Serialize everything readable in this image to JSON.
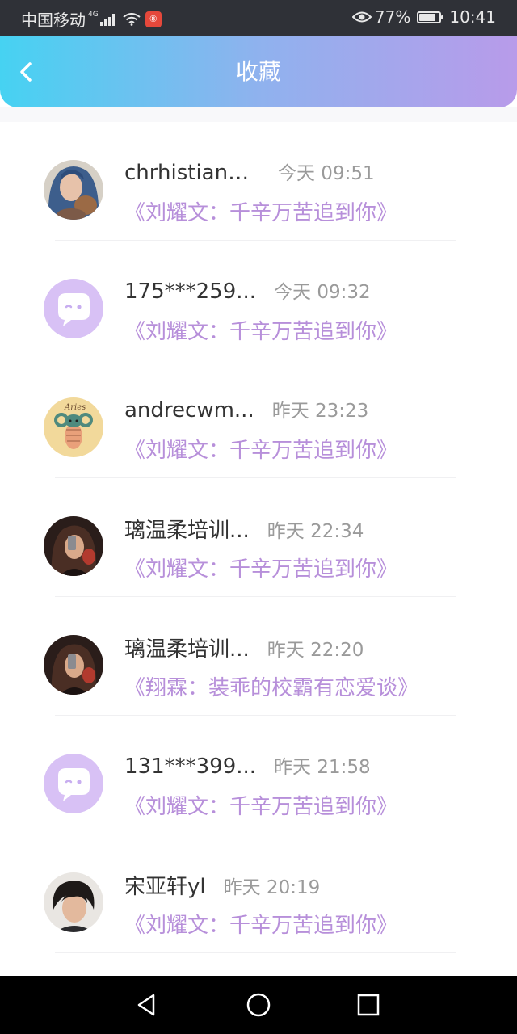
{
  "status_bar": {
    "carrier": "中国移动",
    "network": "4G",
    "app_badge": "⑧",
    "battery_percent": "77%",
    "battery_level": 0.77,
    "time": "10:41"
  },
  "header": {
    "title": "收藏",
    "back_icon": "chevron-left-icon",
    "gradient_colors": [
      "#46d2f2",
      "#b89bea"
    ]
  },
  "favorites": [
    {
      "username": "chrhistiand...",
      "time": "今天 09:51",
      "title": "《刘耀文：千辛万苦追到你》",
      "avatar": "photo-blue-hair"
    },
    {
      "username": "175***259...",
      "time": "今天 09:32",
      "title": "《刘耀文：千辛万苦追到你》",
      "avatar": "default-chat-bubble"
    },
    {
      "username": "andrecwm...",
      "time": "昨天 23:23",
      "title": "《刘耀文：千辛万苦追到你》",
      "avatar": "aries-sheep"
    },
    {
      "username": "璃温柔培训...",
      "time": "昨天 22:34",
      "title": "《刘耀文：千辛万苦追到你》",
      "avatar": "photo-dark-portrait"
    },
    {
      "username": "璃温柔培训...",
      "time": "昨天 22:20",
      "title": "《翔霖：装乖的校霸有恋爱谈》",
      "avatar": "photo-dark-portrait"
    },
    {
      "username": "131***399...",
      "time": "昨天 21:58",
      "title": "《刘耀文：千辛万苦追到你》",
      "avatar": "default-chat-bubble"
    },
    {
      "username": "宋亚轩yl",
      "time": "昨天 20:19",
      "title": "《刘耀文：千辛万苦追到你》",
      "avatar": "photo-boy"
    }
  ],
  "colors": {
    "title_link": "#b78fda",
    "username": "#333333",
    "time": "#9a9a9a",
    "default_avatar_bg": "#d8c1f5"
  },
  "nav_bar": {
    "back_icon": "triangle-back-icon",
    "home_icon": "circle-home-icon",
    "recents_icon": "square-recents-icon"
  }
}
